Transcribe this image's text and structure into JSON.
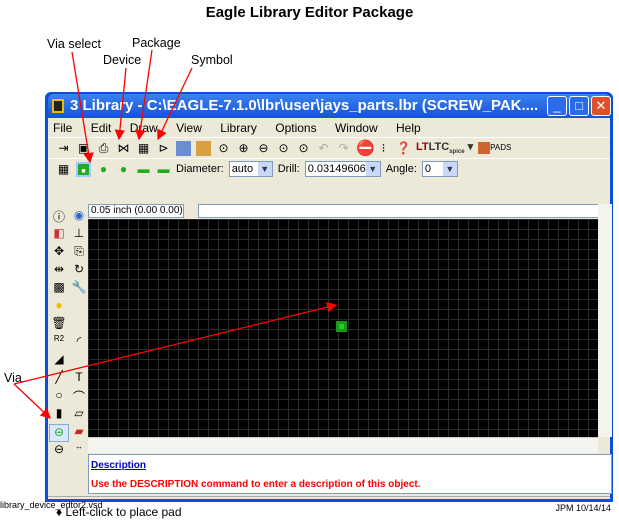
{
  "page_title": "Eagle Library Editor Package",
  "annotations": {
    "via_select": "Via select",
    "device": "Device",
    "package": "Package",
    "symbol": "Symbol",
    "via": "Via"
  },
  "window": {
    "title": "3 Library - C:\\EAGLE-7.1.0\\lbr\\user\\jays_parts.lbr (SCREW_PAK....",
    "menu": [
      "File",
      "Edit",
      "Draw",
      "View",
      "Library",
      "Options",
      "Window",
      "Help"
    ],
    "toolbar2": {
      "diameter_label": "Diameter:",
      "diameter_value": "auto",
      "drill_label": "Drill:",
      "drill_value": "0.03149606",
      "angle_label": "Angle:",
      "angle_value": "0"
    },
    "grid_readout": "0.05 inch (0.00 0.00)",
    "command_value": "",
    "ltc_label": "LTC",
    "ltc_sub": "spice",
    "pads_label": "PADS",
    "description": {
      "heading": "Description",
      "text": "Use the DESCRIPTION command to enter a description of this object."
    },
    "status": "Left-click to place pad"
  },
  "footer": {
    "file": "library_device_edtor2.vsd",
    "author_date": "JPM 10/14/14"
  },
  "colors": {
    "annotation_arrow": "#ff0000",
    "pad": "#22cc22",
    "titlebar": "#1552d6"
  }
}
